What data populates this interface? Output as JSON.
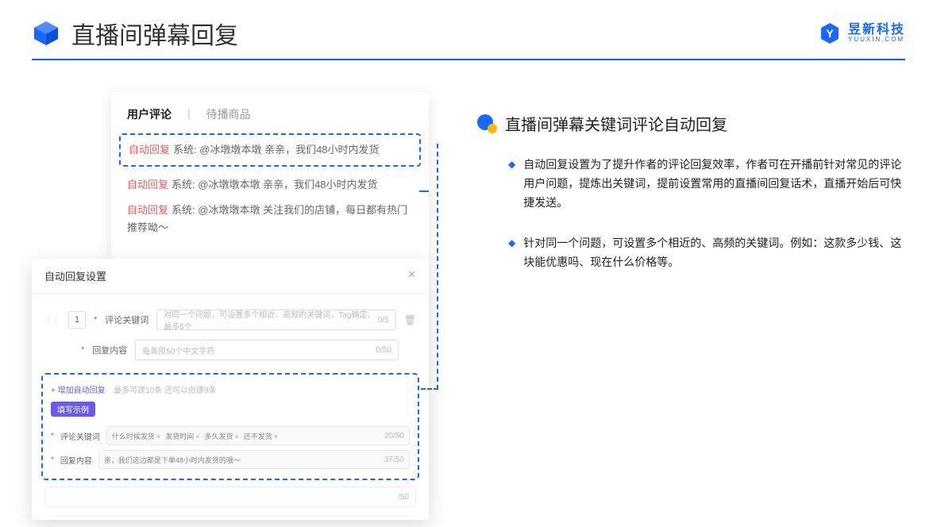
{
  "header": {
    "title": "直播间弹幕回复",
    "logo_cn": "昱新科技",
    "logo_en": "YUUXIN.COM"
  },
  "comment_card": {
    "tab_active": "用户评论",
    "tab_inactive": "待播商品",
    "items": [
      {
        "tag": "自动回复",
        "sys": "系统:",
        "text": "@冰墩墩本墩 亲亲，我们48小时内发货"
      },
      {
        "tag": "自动回复",
        "sys": "系统:",
        "text": "@冰墩墩本墩 亲亲，我们48小时内发货"
      },
      {
        "tag": "自动回复",
        "sys": "系统:",
        "text": "@冰墩墩本墩 关注我们的店铺，每日都有热门推荐呦～"
      }
    ]
  },
  "modal": {
    "title": "自动回复设置",
    "index": "1",
    "label_keyword": "评论关键词",
    "placeholder_keyword": "对同一个问题，可设置多个相近、高频的关键词，Tag确定，最多5个",
    "counter_keyword": "0/5",
    "label_content": "回复内容",
    "placeholder_content": "每条限50个中文字符",
    "counter_content": "0/50",
    "add_link": "+ 增加自动回复",
    "add_hint": "最多可建10条 还可以创建9条",
    "badge": "填写示例",
    "example_keyword_label": "评论关键词",
    "tags": [
      "什么时候发货",
      "发货时间",
      "多久发货",
      "还不发货"
    ],
    "example_kw_counter": "20/50",
    "example_content_label": "回复内容",
    "example_content_value": "亲，我们这边都是下单48小时内发货的哦～",
    "example_content_counter": "37/50",
    "bottom_counter": "/50"
  },
  "right": {
    "section_title": "直播间弹幕关键词评论自动回复",
    "bullets": [
      "自动回复设置为了提升作者的评论回复效率，作者可在开播前针对常见的评论用户问题，提炼出关键词，提前设置常用的直播间回复话术，直播开始后可快捷发送。",
      "针对同一个问题，可设置多个相近的、高频的关键词。例如：这款多少钱、这块能优惠吗、现在什么价格等。"
    ]
  }
}
